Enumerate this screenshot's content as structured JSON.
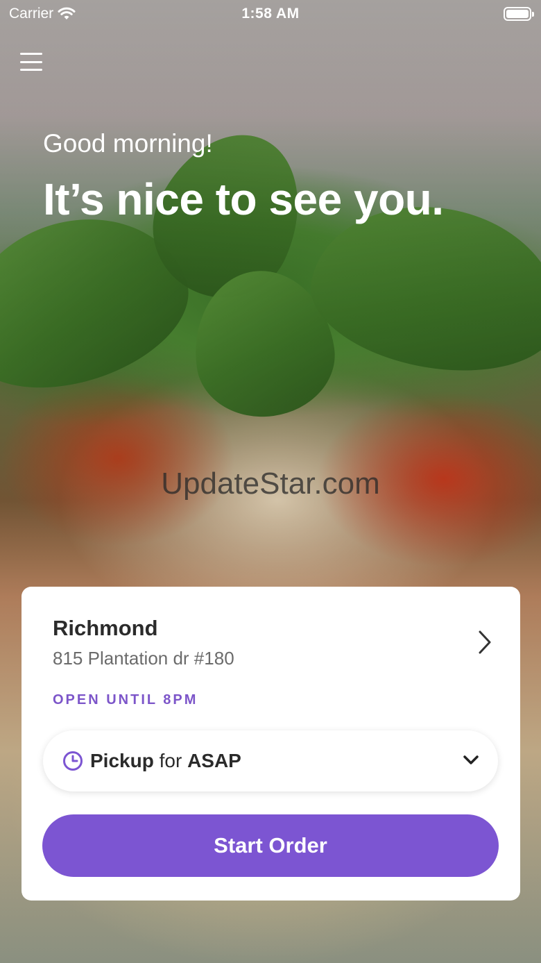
{
  "status_bar": {
    "carrier": "Carrier",
    "time": "1:58 AM"
  },
  "hero": {
    "greeting": "Good morning!",
    "headline": "It’s nice to see you."
  },
  "watermark": "UpdateStar.com",
  "location": {
    "name": "Richmond",
    "address": "815 Plantation dr #180",
    "open_status": "OPEN UNTIL 8PM"
  },
  "order_type": {
    "mode": "Pickup",
    "connector": "for",
    "time": "ASAP"
  },
  "start_order_label": "Start Order",
  "colors": {
    "accent": "#7c55d2",
    "open_status": "#7c55c9"
  },
  "icons": {
    "menu": "hamburger-menu-icon",
    "wifi": "wifi-icon",
    "battery": "battery-icon",
    "chevron_right": "chevron-right-icon",
    "clock": "clock-icon",
    "chevron_down": "chevron-down-icon"
  }
}
